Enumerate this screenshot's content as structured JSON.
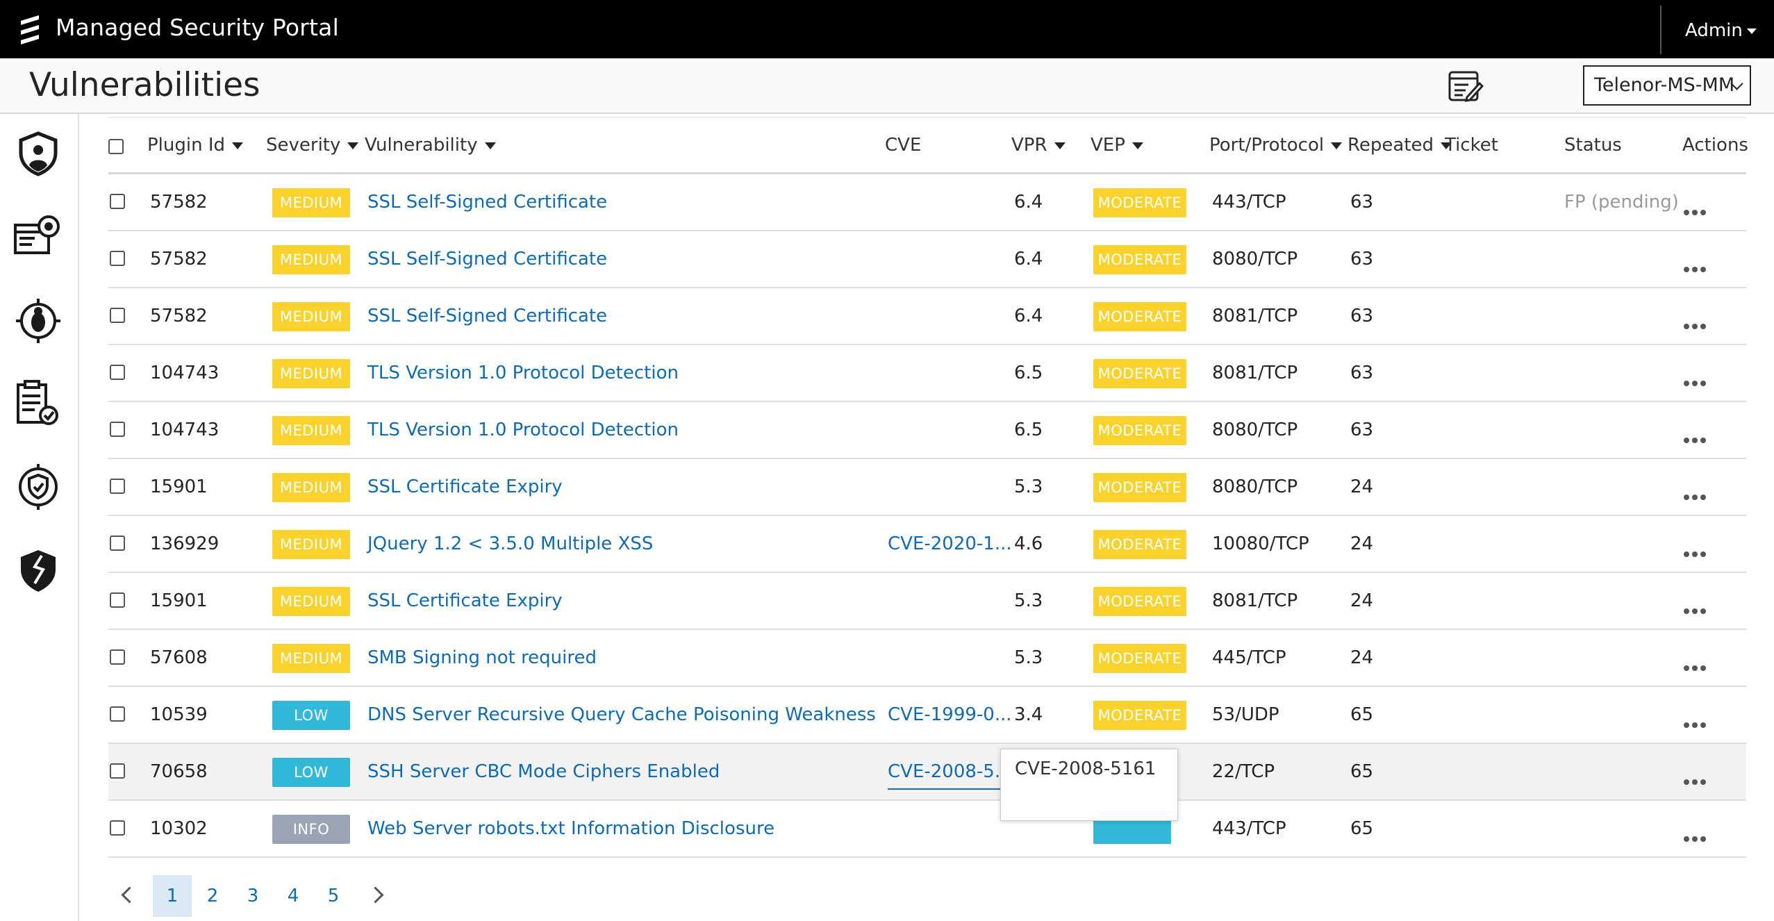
{
  "header": {
    "app_title": "Managed Security Portal",
    "user_menu": "Admin",
    "logo_icon": "ericsson-logo-icon"
  },
  "titlebar": {
    "page_title": "Vulnerabilities",
    "report_icon": "report-edit-icon",
    "tenant": "Telenor-MS-MM"
  },
  "sidebar": {
    "items": [
      {
        "name": "shield-user-icon"
      },
      {
        "name": "threat-report-icon"
      },
      {
        "name": "bug-target-icon"
      },
      {
        "name": "checklist-icon"
      },
      {
        "name": "shield-ring-icon"
      },
      {
        "name": "broken-shield-icon"
      }
    ]
  },
  "table": {
    "columns": {
      "plugin_id": "Plugin Id",
      "severity": "Severity",
      "vulnerability": "Vulnerability",
      "cve": "CVE",
      "vpr": "VPR",
      "vep": "VEP",
      "port": "Port/Protocol",
      "repeated": "Repeated",
      "ticket": "Ticket",
      "status": "Status",
      "actions": "Actions"
    },
    "rows": [
      {
        "plugin_id": "57582",
        "severity": "MEDIUM",
        "vulnerability": "SSL Self-Signed Certificate",
        "cve": "",
        "vpr": "6.4",
        "vep": "MODERATE",
        "port": "443/TCP",
        "repeated": "63",
        "ticket": "",
        "status": "FP (pending)"
      },
      {
        "plugin_id": "57582",
        "severity": "MEDIUM",
        "vulnerability": "SSL Self-Signed Certificate",
        "cve": "",
        "vpr": "6.4",
        "vep": "MODERATE",
        "port": "8080/TCP",
        "repeated": "63",
        "ticket": "",
        "status": ""
      },
      {
        "plugin_id": "57582",
        "severity": "MEDIUM",
        "vulnerability": "SSL Self-Signed Certificate",
        "cve": "",
        "vpr": "6.4",
        "vep": "MODERATE",
        "port": "8081/TCP",
        "repeated": "63",
        "ticket": "",
        "status": ""
      },
      {
        "plugin_id": "104743",
        "severity": "MEDIUM",
        "vulnerability": "TLS Version 1.0 Protocol Detection",
        "cve": "",
        "vpr": "6.5",
        "vep": "MODERATE",
        "port": "8081/TCP",
        "repeated": "63",
        "ticket": "",
        "status": ""
      },
      {
        "plugin_id": "104743",
        "severity": "MEDIUM",
        "vulnerability": "TLS Version 1.0 Protocol Detection",
        "cve": "",
        "vpr": "6.5",
        "vep": "MODERATE",
        "port": "8080/TCP",
        "repeated": "63",
        "ticket": "",
        "status": ""
      },
      {
        "plugin_id": "15901",
        "severity": "MEDIUM",
        "vulnerability": "SSL Certificate Expiry",
        "cve": "",
        "vpr": "5.3",
        "vep": "MODERATE",
        "port": "8080/TCP",
        "repeated": "24",
        "ticket": "",
        "status": ""
      },
      {
        "plugin_id": "136929",
        "severity": "MEDIUM",
        "vulnerability": "JQuery 1.2 < 3.5.0 Multiple XSS",
        "cve": "CVE-2020-1...",
        "vpr": "4.6",
        "vep": "MODERATE",
        "port": "10080/TCP",
        "repeated": "24",
        "ticket": "",
        "status": ""
      },
      {
        "plugin_id": "15901",
        "severity": "MEDIUM",
        "vulnerability": "SSL Certificate Expiry",
        "cve": "",
        "vpr": "5.3",
        "vep": "MODERATE",
        "port": "8081/TCP",
        "repeated": "24",
        "ticket": "",
        "status": ""
      },
      {
        "plugin_id": "57608",
        "severity": "MEDIUM",
        "vulnerability": "SMB Signing not required",
        "cve": "",
        "vpr": "5.3",
        "vep": "MODERATE",
        "port": "445/TCP",
        "repeated": "24",
        "ticket": "",
        "status": ""
      },
      {
        "plugin_id": "10539",
        "severity": "LOW",
        "vulnerability": "DNS Server Recursive Query Cache Poisoning Weakness",
        "cve": "CVE-1999-0...",
        "vpr": "3.4",
        "vep": "MODERATE",
        "port": "53/UDP",
        "repeated": "65",
        "ticket": "",
        "status": ""
      },
      {
        "plugin_id": "70658",
        "severity": "LOW",
        "vulnerability": "SSH Server CBC Mode Ciphers Enabled",
        "cve": "CVE-2008-5...",
        "vpr": "",
        "vep": "",
        "port": "22/TCP",
        "repeated": "65",
        "ticket": "",
        "status": ""
      },
      {
        "plugin_id": "10302",
        "severity": "INFO",
        "vulnerability": "Web Server robots.txt Information Disclosure",
        "cve": "",
        "vpr": "",
        "vep": "",
        "port": "443/TCP",
        "repeated": "65",
        "ticket": "",
        "status": ""
      }
    ]
  },
  "tooltip": {
    "text": "CVE-2008-5161"
  },
  "pagination": {
    "pages": [
      "1",
      "2",
      "3",
      "4",
      "5"
    ],
    "current": "1"
  },
  "colors": {
    "medium": "#fad22d",
    "low": "#32b9d9",
    "info": "#9aa4b5",
    "link": "#0f6ab4"
  }
}
